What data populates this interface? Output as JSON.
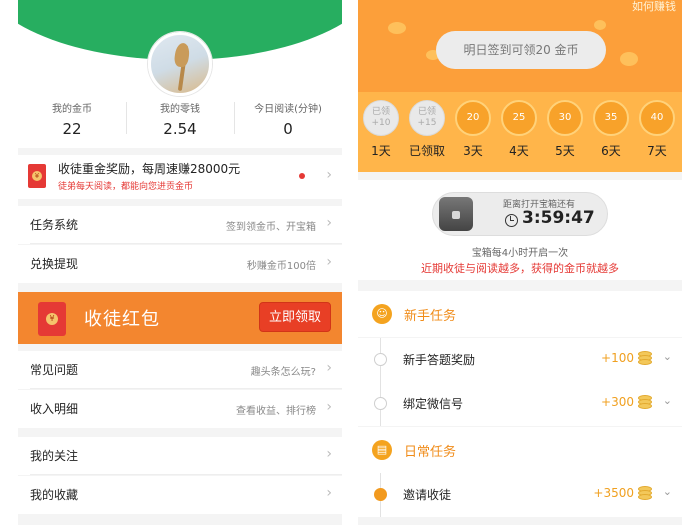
{
  "left": {
    "stats": [
      {
        "label": "我的金币",
        "value": "22"
      },
      {
        "label": "我的零钱",
        "value": "2.54"
      },
      {
        "label": "今日阅读(分钟)",
        "value": "0"
      }
    ],
    "reward": {
      "title": "收徒重金奖励，每周速赚28000元",
      "subtitle": "徒弟每天阅读，都能向您进贡金币",
      "envelope_glyph": "¥"
    },
    "menu1": [
      {
        "label": "任务系统",
        "hint": "签到领金币、开宝箱"
      },
      {
        "label": "兑换提现",
        "hint": "秒赚金币100倍"
      }
    ],
    "banner": {
      "title": "收徒红包",
      "button": "立即领取",
      "envelope_glyph": "¥"
    },
    "menu2": [
      {
        "label": "常见问题",
        "hint": "趣头条怎么玩?"
      },
      {
        "label": "收入明细",
        "hint": "查看收益、排行榜"
      }
    ],
    "menu3": [
      {
        "label": "我的关注",
        "hint": ""
      },
      {
        "label": "我的收藏",
        "hint": ""
      }
    ],
    "chevron": "›",
    "colors": {
      "green": "#27ae60",
      "orange": "#f3862f",
      "red": "#e53935"
    }
  },
  "right": {
    "corner_text": "如何赚钱",
    "signin_button": "明日签到可领20 金币",
    "days": [
      {
        "reward": "已领\n+10",
        "label": "1天",
        "done": true
      },
      {
        "reward": "已领\n+15",
        "label": "已领取",
        "done": true
      },
      {
        "reward": "20",
        "label": "3天",
        "done": false
      },
      {
        "reward": "25",
        "label": "4天",
        "done": false
      },
      {
        "reward": "30",
        "label": "5天",
        "done": false
      },
      {
        "reward": "35",
        "label": "6天",
        "done": false
      },
      {
        "reward": "40",
        "label": "7天",
        "done": false
      }
    ],
    "chest": {
      "label": "距离打开宝箱还有",
      "time": "3:59:47",
      "info1": "宝箱每4小时开启一次",
      "info2": "近期收徒与阅读越多，获得的金币就越多"
    },
    "section_new": {
      "title": "新手任务",
      "icon": "person-icon"
    },
    "tasks_new": [
      {
        "name": "新手答题奖励",
        "reward": "+100"
      },
      {
        "name": "绑定微信号",
        "reward": "+300"
      }
    ],
    "section_daily": {
      "title": "日常任务",
      "icon": "calendar-icon"
    },
    "tasks_daily": [
      {
        "name": "邀请收徒",
        "reward": "+3500"
      }
    ],
    "chevron_down": "⌄",
    "colors": {
      "orange": "#f29a1f",
      "banner": "#ffb54a"
    }
  }
}
